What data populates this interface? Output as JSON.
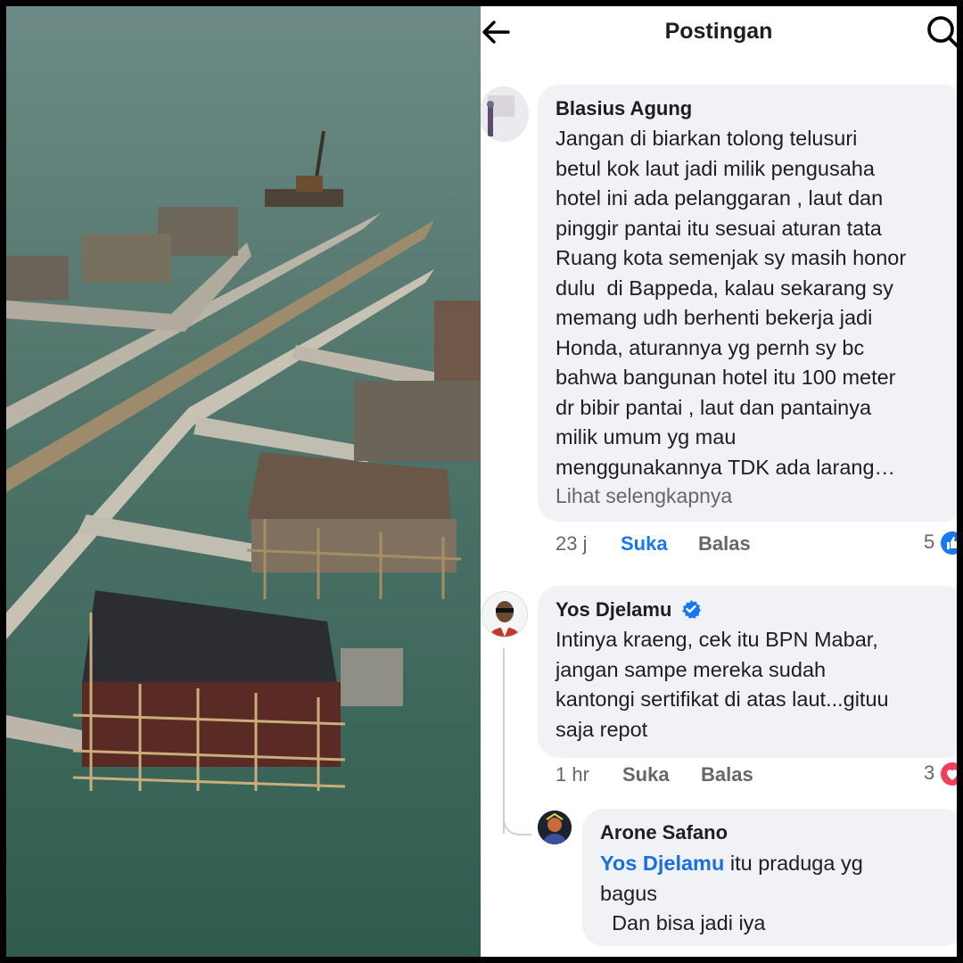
{
  "header": {
    "title": "Postingan",
    "back_icon": "arrow-left-icon",
    "search_icon": "search-icon"
  },
  "comments": [
    {
      "author": "Blasius Agung",
      "text": "Jangan di biarkan tolong telusuri\nbetul kok laut jadi milik pengusaha\nhotel ini ada pelanggaran , laut dan\npinggir pantai itu sesuai aturan tata\nRuang kota semenjak sy masih honor\ndulu  di Bappeda, kalau sekarang sy\nmemang udh berhenti bekerja jadi\nHonda, aturannya yg pernh sy bc\nbahwa bangunan hotel itu 100 meter\ndr bibir pantai , laut dan pantainya\nmilik umum yg mau\nmenggunakannya TDK ada larang…",
      "see_more": "Lihat selengkapnya",
      "time": "23 j",
      "like": "Suka",
      "reply": "Balas",
      "reactions": "5",
      "reaction_icon": "like-icon"
    },
    {
      "author": "Yos Djelamu",
      "verified_icon": "verified-badge-icon",
      "text": "Intinya kraeng, cek itu BPN Mabar,\njangan sampe mereka sudah\nkantongi sertifikat di atas laut...gituu\nsaja repot",
      "time": "1 hr",
      "like": "Suka",
      "reply": "Balas",
      "reactions": "3",
      "reaction_icon": "heart-icon"
    }
  ],
  "reply": {
    "author": "Arone Safano",
    "mention": "Yos Djelamu",
    "text_after_mention": " itu praduga yg\nbagus\n  Dan bisa jadi iya"
  },
  "colors": {
    "accent": "#1877f2",
    "bubble": "#f0f2f5",
    "muted": "#65676b",
    "heart": "#f33e58"
  }
}
